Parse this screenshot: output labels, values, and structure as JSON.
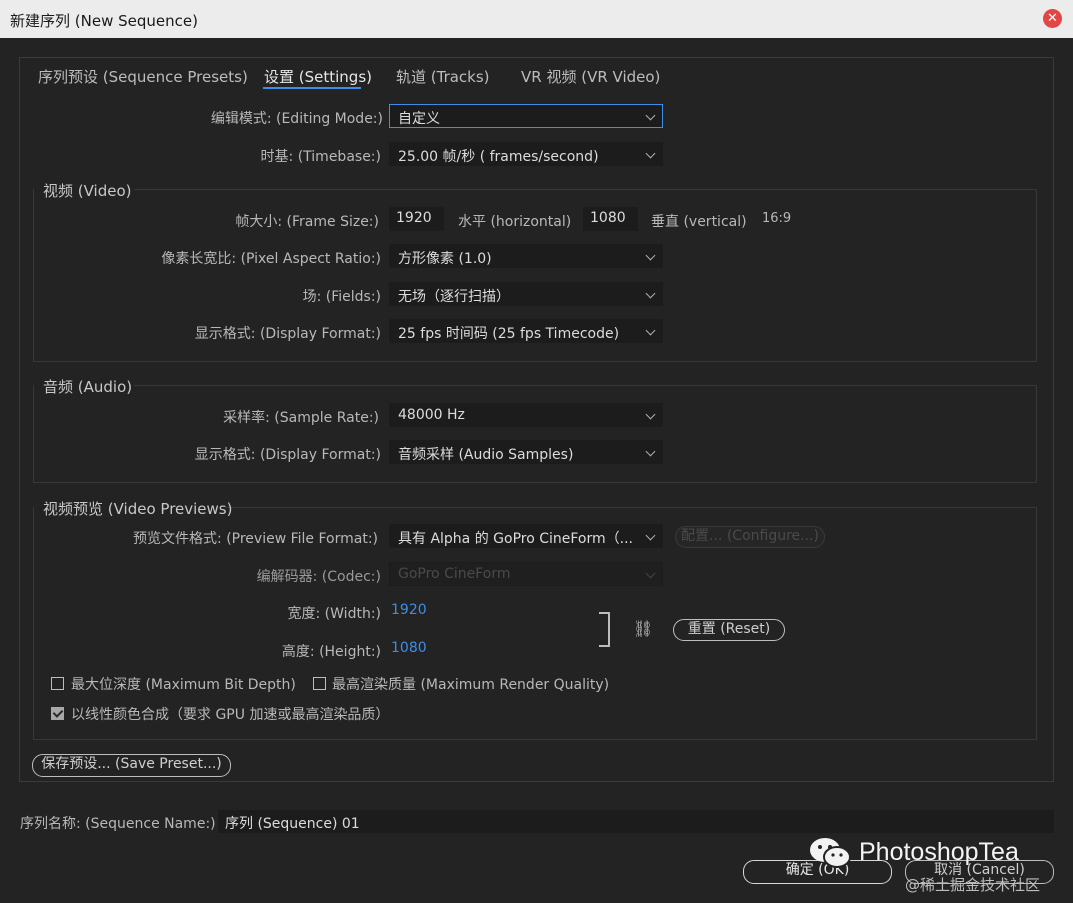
{
  "window": {
    "title": "新建序列 (New Sequence)",
    "close_glyph": "✕"
  },
  "tabs": [
    {
      "label": "序列预设 (Sequence Presets)"
    },
    {
      "label": "设置 (Settings)",
      "active": true
    },
    {
      "label": "轨道 (Tracks)"
    },
    {
      "label": "VR 视频 (VR Video)"
    }
  ],
  "general": {
    "editing_mode_label": "编辑模式: (Editing Mode:)",
    "editing_mode_value": "自定义",
    "timebase_label": "时基: (Timebase:)",
    "timebase_value": "25.00  帧/秒 ( frames/second)"
  },
  "video": {
    "title": "视频 (Video)",
    "frame_size_label": "帧大小: (Frame Size:)",
    "width": "1920",
    "horizontal_label": "水平 (horizontal)",
    "height": "1080",
    "vertical_label": "垂直 (vertical)",
    "aspect": "16:9",
    "par_label": "像素长宽比: (Pixel Aspect Ratio:)",
    "par_value": "方形像素 (1.0)",
    "fields_label": "场: (Fields:)",
    "fields_value": "无场（逐行扫描）",
    "display_format_label": "显示格式: (Display Format:)",
    "display_format_value": "25 fps 时间码 (25 fps Timecode)"
  },
  "audio": {
    "title": "音频 (Audio)",
    "sample_rate_label": "采样率: (Sample Rate:)",
    "sample_rate_value": "48000 Hz",
    "display_format_label": "显示格式: (Display Format:)",
    "display_format_value": "音频采样 (Audio Samples)"
  },
  "previews": {
    "title": "视频预览 (Video Previews)",
    "file_format_label": "预览文件格式: (Preview File Format:)",
    "file_format_value": "具有 Alpha 的 GoPro CineForm（...",
    "configure_label": "配置... (Configure...)",
    "codec_label": "编解码器: (Codec:)",
    "codec_value": "GoPro CineForm",
    "width_label": "宽度: (Width:)",
    "width_value": "1920",
    "height_label": "高度: (Height:)",
    "height_value": "1080",
    "link_glyph": "⛓",
    "reset_label": "重置 (Reset)",
    "max_bit_depth_label": "最大位深度 (Maximum Bit Depth)",
    "max_bit_depth_checked": false,
    "max_render_label": "最高渲染质量 (Maximum Render Quality)",
    "max_render_checked": false,
    "linear_color_label": "以线性颜色合成（要求 GPU 加速或最高渲染品质）",
    "linear_color_checked": true
  },
  "save_preset_label": "保存预设... (Save Preset...)",
  "sequence_name_label": "序列名称: (Sequence Name:)",
  "sequence_name_value": "序列 (Sequence) 01",
  "ok_label": "确定 (OK)",
  "cancel_label": "取消 (Cancel)",
  "watermark": {
    "brand": "PhotoshopTea",
    "community": "@稀土掘金技术社区"
  },
  "colors": {
    "accent": "#3d8ee8",
    "close": "#e34545"
  }
}
